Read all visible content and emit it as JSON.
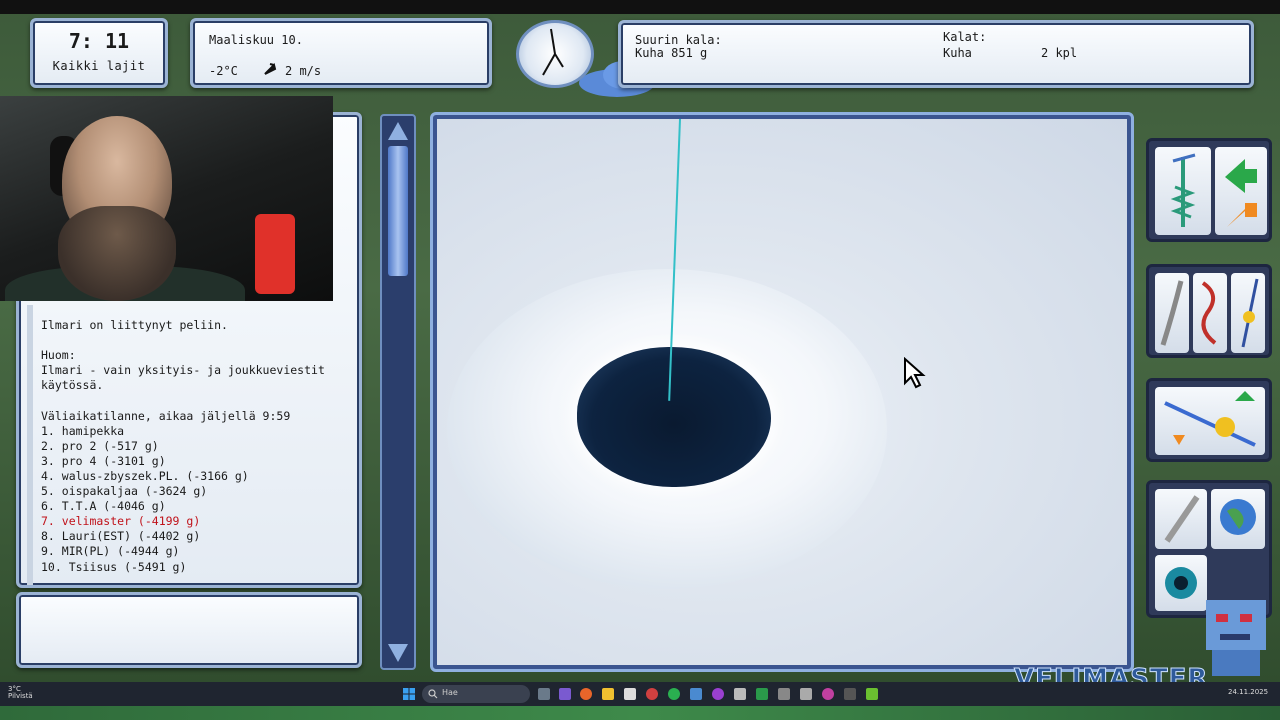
{
  "clock": {
    "time": "7: 11",
    "label": "Kaikki lajit"
  },
  "weather": {
    "date": "Maaliskuu 10.",
    "temperature": "-2°C",
    "wind": "2 m/s"
  },
  "catch": {
    "biggest_title": "Suurin kala:",
    "biggest_value": "Kuha 851 g",
    "fish_title": "Kalat:",
    "fish_species": "Kuha",
    "fish_count": "2 kpl"
  },
  "chat": {
    "lines": [
      {
        "text": "Ilmari on liittynyt peliin.",
        "highlight": false
      },
      {
        "text": "",
        "highlight": false
      },
      {
        "text": "Huom:",
        "highlight": false
      },
      {
        "text": "Ilmari - vain yksityis- ja joukkueviestit",
        "highlight": false
      },
      {
        "text": "käytössä.",
        "highlight": false
      },
      {
        "text": "",
        "highlight": false
      },
      {
        "text": "Väliaikatilanne, aikaa jäljellä 9:59",
        "highlight": false
      },
      {
        "text": "1. hamipekka",
        "highlight": false
      },
      {
        "text": "2. pro 2 (-517 g)",
        "highlight": false
      },
      {
        "text": "3. pro 4 (-3101 g)",
        "highlight": false
      },
      {
        "text": "4. walus-zbyszek.PL. (-3166 g)",
        "highlight": false
      },
      {
        "text": "5. oispakaljaa (-3624 g)",
        "highlight": false
      },
      {
        "text": "6. T.T.A (-4046 g)",
        "highlight": false
      },
      {
        "text": "7. velimaster (-4199 g)",
        "highlight": true
      },
      {
        "text": "8. Lauri(EST) (-4402 g)",
        "highlight": false
      },
      {
        "text": "9. MIR(PL) (-4944 g)",
        "highlight": false
      },
      {
        "text": "10. Tsiisus (-5491 g)",
        "highlight": false
      }
    ],
    "input_value": ""
  },
  "watermark": "VELIMASTER",
  "taskbar": {
    "weather_temp": "3°C",
    "weather_desc": "Pilvistä",
    "search_placeholder": "Hae",
    "date": "24.11.2025"
  },
  "colors": {
    "panel_border": "#9bb3d4",
    "highlight": "#c0121a",
    "line": "#33c0c8"
  },
  "icons": [
    "wind-arrow-icon",
    "cloud-sun-icon",
    "compass-icon",
    "cursor-icon",
    "ice-drill-icon",
    "move-arrows-icon",
    "lure-icon",
    "worm-icon",
    "jig-icon",
    "rod-icon",
    "knife-icon",
    "globe-icon",
    "eye-icon",
    "search-icon",
    "windows-start-icon"
  ]
}
